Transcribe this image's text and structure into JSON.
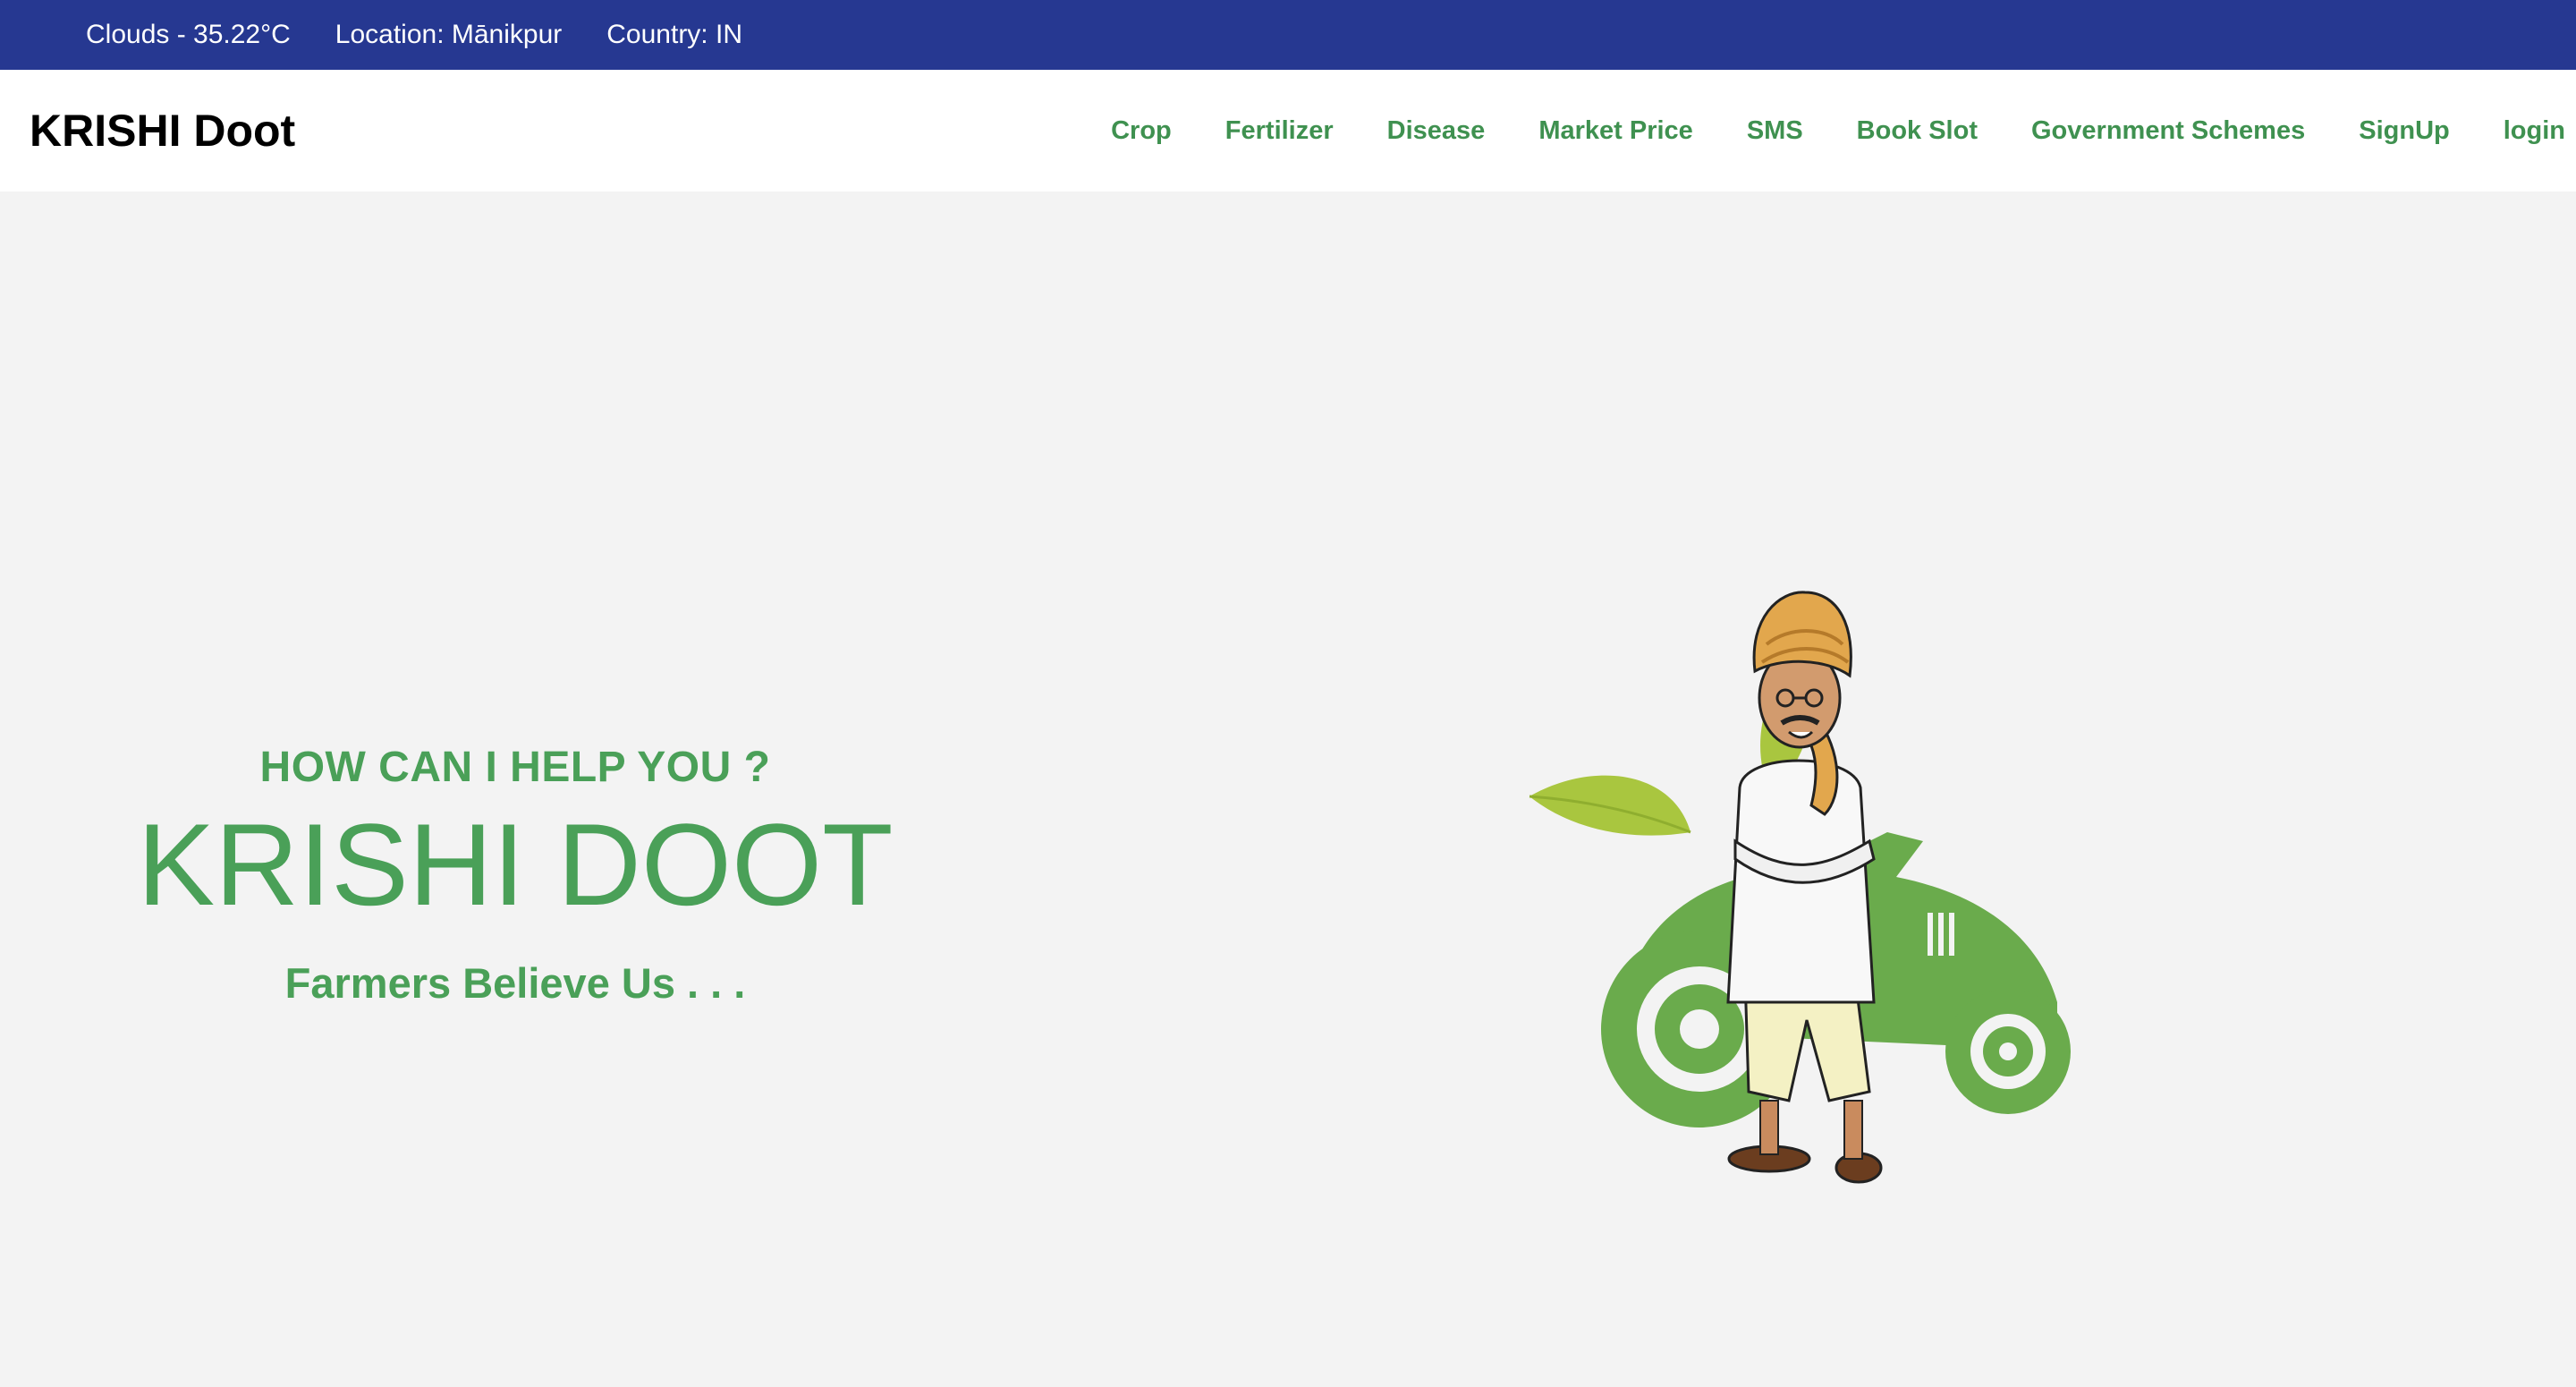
{
  "topbar": {
    "weather": "Clouds - 35.22°C",
    "location": "Location: Mānikpur",
    "country": "Country: IN"
  },
  "navbar": {
    "brand": "KRISHI Doot",
    "links": [
      "Crop",
      "Fertilizer",
      "Disease",
      "Market Price",
      "SMS",
      "Book Slot",
      "Government Schemes",
      "SignUp",
      "login"
    ]
  },
  "hero": {
    "question": "HOW CAN I HELP YOU ?",
    "title": "KRISHI DOOT",
    "tagline": "Farmers Believe Us . . ."
  },
  "colors": {
    "topbar_bg": "#263891",
    "accent_green": "#4aa058",
    "nav_green": "#3f9150",
    "page_bg": "#f3f3f3"
  },
  "icons": {
    "hero_image": "farmer-with-tractor-and-leaf-illustration"
  }
}
